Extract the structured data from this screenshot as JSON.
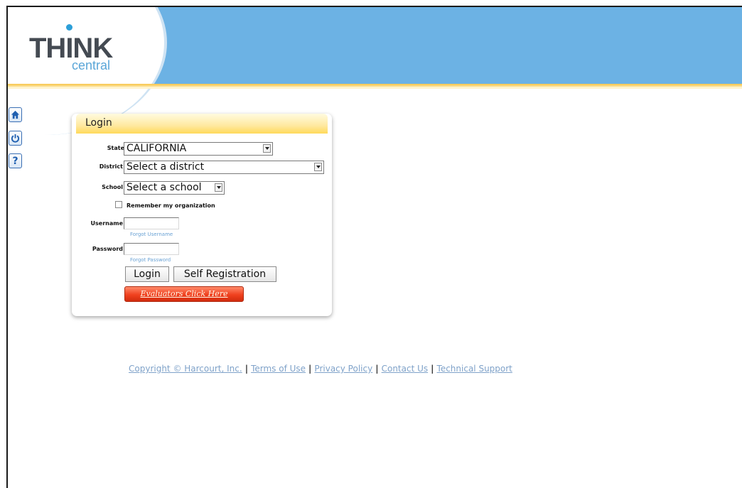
{
  "header": {
    "logo_think": "THINK",
    "logo_central": "central"
  },
  "side_icons": [
    "home-icon",
    "power-icon",
    "help-icon"
  ],
  "login": {
    "title": "Login",
    "state_label": "State",
    "state_value": "CALIFORNIA",
    "district_label": "District",
    "district_value": "Select a district",
    "school_label": "School",
    "school_value": "Select a school",
    "remember_label": "Remember my organization",
    "username_label": "Username",
    "forgot_username": "Forgot Username",
    "password_label": "Password",
    "forgot_password": "Forgot Password",
    "login_button": "Login",
    "self_registration_button": "Self Registration",
    "evaluators_button": "Evaluators Click Here"
  },
  "footer": {
    "copyright": "Copyright © Harcourt, Inc.",
    "sep": "|",
    "terms": "Terms of Use",
    "privacy": "Privacy Policy",
    "contact": "Contact Us",
    "support": "Technical Support"
  },
  "colors": {
    "header_blue": "#6cb2e4",
    "accent_yellow": "#f7c64a",
    "evaluator_red": "#f0411f"
  }
}
